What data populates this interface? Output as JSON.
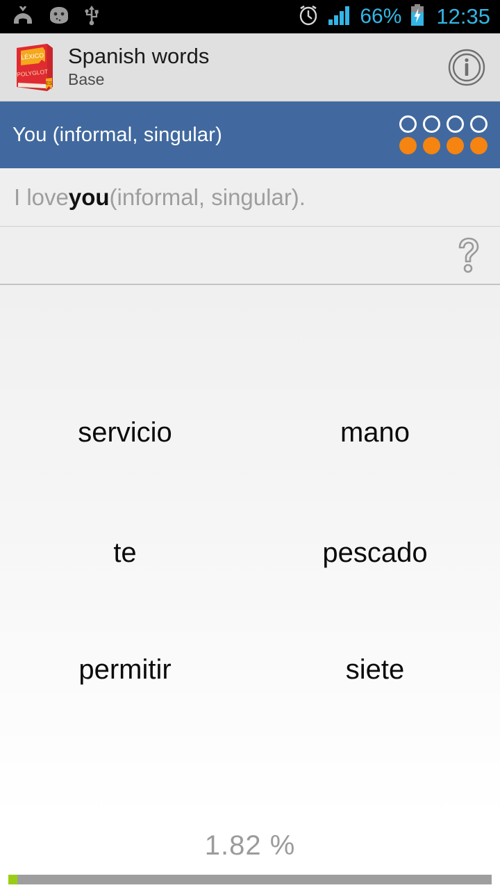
{
  "status_bar": {
    "icons_left": [
      "missed-call-icon",
      "android-debug-icon",
      "usb-icon"
    ],
    "alarm_icon": "alarm-clock-icon",
    "signal_icon": "signal-bars-icon",
    "battery_percent": "66%",
    "battery_icon": "battery-charging-icon",
    "clock": "12:35",
    "accent_color": "#33b5e5",
    "background_color": "#000000"
  },
  "app_bar": {
    "logo_icon": "lexico-polyglot-book-icon",
    "logo_top_label": "LÉXICO",
    "logo_bottom_label": "POLYGLOT",
    "logo_tag": "ES",
    "title": "Spanish words",
    "subtitle": "Base",
    "info_icon": "info-icon",
    "background_color": "#e0e0e0"
  },
  "question_bar": {
    "prompt": "You (informal, singular)",
    "background_color": "#41699f",
    "dots_top": [
      "hollow",
      "hollow",
      "hollow",
      "hollow"
    ],
    "dots_bottom": [
      "filled",
      "filled",
      "filled",
      "filled"
    ],
    "filled_color": "#f58410"
  },
  "sentence": {
    "before": "I love ",
    "highlight": "you",
    "after": " (informal, singular)."
  },
  "answer_row": {
    "value": "",
    "hint_icon": "question-mark-icon"
  },
  "options": [
    [
      "servicio",
      "mano"
    ],
    [
      "te",
      "pescado"
    ],
    [
      "permitir",
      "siete"
    ]
  ],
  "footer": {
    "percent_label": "1.82 %",
    "progress_value": 1.82,
    "progress_fill_color": "#9acd18",
    "progress_track_color": "#9e9e9e"
  }
}
